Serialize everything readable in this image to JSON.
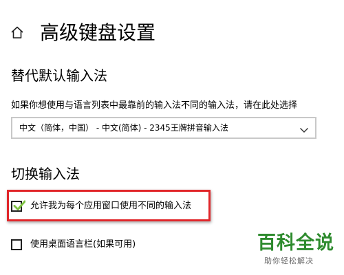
{
  "header": {
    "home_icon": "home-icon",
    "title": "高级键盘设置"
  },
  "default_input": {
    "heading": "替代默认输入法",
    "description": "如果你想使用与语言列表中最靠前的输入法不同的输入法，请在此处选择",
    "dropdown_value": "中文（简体，中国） - 中文(简体) - 2345王牌拼音输入法"
  },
  "switch_input": {
    "heading": "切换输入法",
    "per_app_checkbox": {
      "label": "允许我为每个应用窗口使用不同的输入法",
      "checked": true
    },
    "language_bar_checkbox": {
      "label": "使用桌面语言栏(如果可用)",
      "checked": false
    }
  },
  "annotation": {
    "highlight_color": "#e1262a",
    "checkmark_color": "#7ec242"
  },
  "watermark": {
    "main": "百科全说",
    "sub": "助你轻松解决",
    "color": "#2e8b2e"
  }
}
